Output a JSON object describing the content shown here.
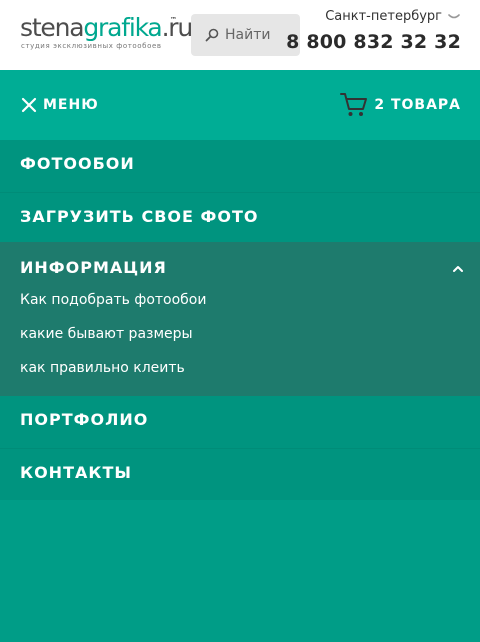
{
  "header": {
    "logo": {
      "part1": "stena",
      "part2": "grafika",
      "part3": ".ru",
      "tm": "™",
      "tagline": "студия эксклюзивных фотообоев"
    },
    "search": {
      "placeholder": "Найти",
      "value": ""
    },
    "city": "Санкт-петербург",
    "phone": "8 800 832 32 32"
  },
  "menu_bar": {
    "menu_label": "МЕНЮ",
    "cart_label": "2 ТОВАРА"
  },
  "nav": {
    "items": [
      {
        "label": "ФОТООБОИ"
      },
      {
        "label": "ЗАГРУЗИТЬ СВОЕ ФОТО"
      },
      {
        "label": "ИНФОРМАЦИЯ",
        "expanded": true,
        "children": [
          {
            "label": "Как подобрать фотообои"
          },
          {
            "label": "какие бывают размеры"
          },
          {
            "label": "как правильно клеить"
          }
        ]
      },
      {
        "label": "ПОРТФОЛИО"
      },
      {
        "label": "КОНТАКТЫ"
      }
    ]
  },
  "colors": {
    "brand_green": "#00a88f",
    "menu_bar": "#00ad95",
    "nav_bg": "#00947f",
    "nav_expanded_bg": "#1e7b6d",
    "page_bg": "#009d87"
  }
}
